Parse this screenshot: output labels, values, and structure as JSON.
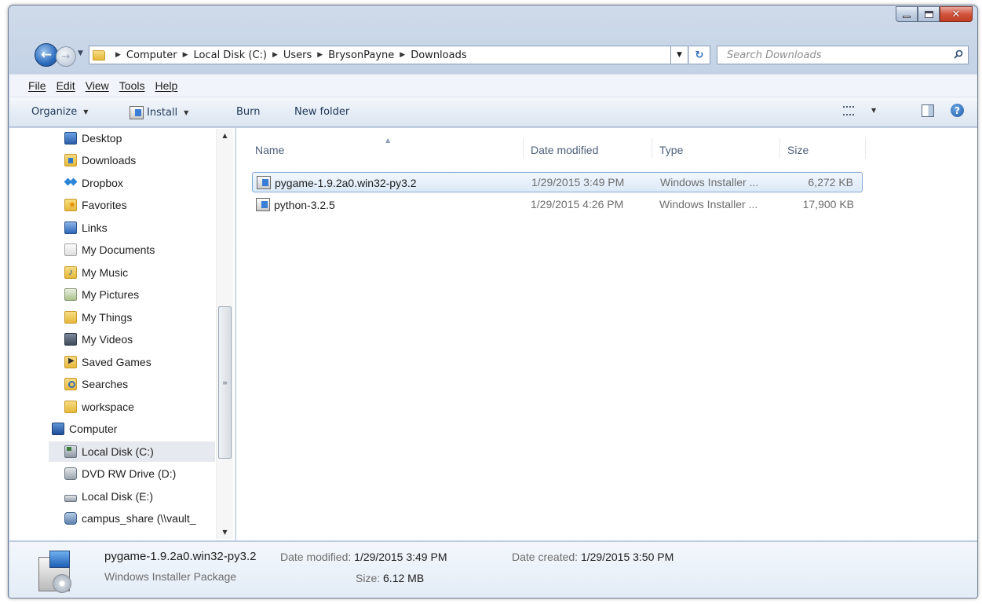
{
  "window": {
    "caption_buttons": [
      "minimize",
      "maximize",
      "close"
    ]
  },
  "address_bar": {
    "crumbs": [
      "Computer",
      "Local Disk (C:)",
      "Users",
      "BrysonPayne",
      "Downloads"
    ],
    "search_placeholder": "Search Downloads"
  },
  "menu": {
    "items": [
      "File",
      "Edit",
      "View",
      "Tools",
      "Help"
    ]
  },
  "toolbar": {
    "organize_label": "Organize",
    "install_label": "Install",
    "burn_label": "Burn",
    "new_folder_label": "New folder"
  },
  "nav_pane": {
    "items": [
      {
        "label": "Desktop",
        "icon": "desktop-icon"
      },
      {
        "label": "Downloads",
        "icon": "downloads-folder-icon"
      },
      {
        "label": "Dropbox",
        "icon": "dropbox-icon"
      },
      {
        "label": "Favorites",
        "icon": "favorites-folder-icon"
      },
      {
        "label": "Links",
        "icon": "links-folder-icon"
      },
      {
        "label": "My Documents",
        "icon": "documents-folder-icon"
      },
      {
        "label": "My Music",
        "icon": "music-folder-icon"
      },
      {
        "label": "My Pictures",
        "icon": "pictures-folder-icon"
      },
      {
        "label": "My Things",
        "icon": "folder-icon"
      },
      {
        "label": "My Videos",
        "icon": "videos-folder-icon"
      },
      {
        "label": "Saved Games",
        "icon": "saved-games-folder-icon"
      },
      {
        "label": "Searches",
        "icon": "searches-folder-icon"
      },
      {
        "label": "workspace",
        "icon": "folder-icon"
      },
      {
        "label": "Computer",
        "icon": "computer-icon"
      },
      {
        "label": "Local Disk (C:)",
        "icon": "local-disk-icon",
        "selected": true
      },
      {
        "label": "DVD RW Drive (D:)",
        "icon": "dvd-drive-icon"
      },
      {
        "label": "Local Disk (E:)",
        "icon": "disk-drive-icon"
      },
      {
        "label": "campus_share (\\\\vault_",
        "icon": "network-share-icon"
      }
    ]
  },
  "file_list": {
    "columns": {
      "name": "Name",
      "date": "Date modified",
      "type": "Type",
      "size": "Size"
    },
    "rows": [
      {
        "name": "pygame-1.9.2a0.win32-py3.2",
        "date": "1/29/2015 3:49 PM",
        "type": "Windows Installer ...",
        "size": "6,272 KB",
        "selected": true
      },
      {
        "name": "python-3.2.5",
        "date": "1/29/2015 4:26 PM",
        "type": "Windows Installer ...",
        "size": "17,900 KB",
        "selected": false
      }
    ]
  },
  "details_pane": {
    "file_name": "pygame-1.9.2a0.win32-py3.2",
    "file_type": "Windows Installer Package",
    "date_modified_label": "Date modified:",
    "date_modified": "1/29/2015 3:49 PM",
    "size_label": "Size:",
    "size": "6.12 MB",
    "date_created_label": "Date created:",
    "date_created": "1/29/2015 3:50 PM"
  },
  "colors": {
    "selection_border": "#86a9d4",
    "chrome": "#c3d2e6",
    "close_button": "#c43d25"
  }
}
